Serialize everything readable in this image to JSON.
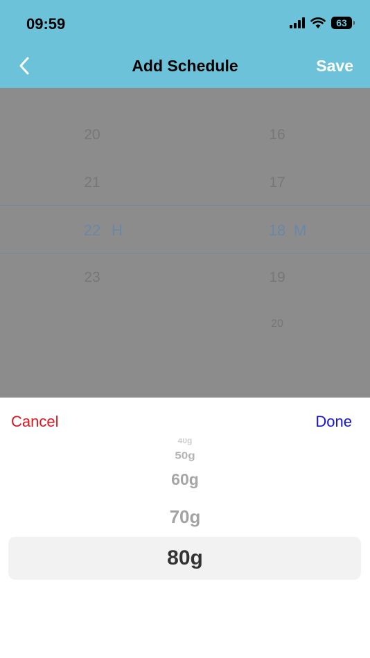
{
  "status_bar": {
    "time": "09:59",
    "battery": "63"
  },
  "header": {
    "title": "Add Schedule",
    "save_label": "Save"
  },
  "time_picker": {
    "hours": {
      "above2": "20",
      "above1": "21",
      "selected": "22",
      "below1": "23",
      "unit": "H"
    },
    "minutes": {
      "above2": "16",
      "above1": "17",
      "selected": "18",
      "below1": "19",
      "below2": "20",
      "unit": "M"
    }
  },
  "sheet": {
    "cancel_label": "Cancel",
    "done_label": "Done",
    "options": [
      "40g",
      "50g",
      "60g",
      "70g",
      "80g"
    ],
    "selected": "80g"
  },
  "colors": {
    "header_bg": "#6cc3d9",
    "cancel": "#e0151c",
    "done": "#1414d4",
    "picker_selected": "#6a88a6"
  }
}
